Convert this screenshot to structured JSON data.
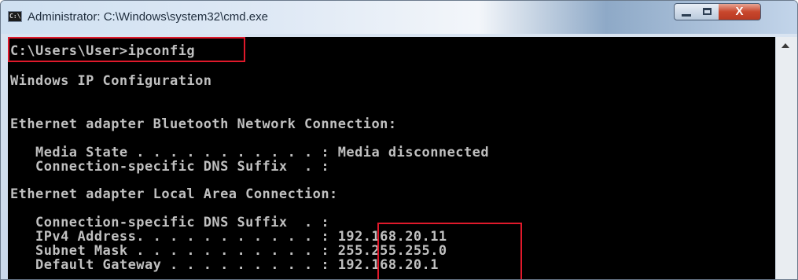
{
  "window": {
    "title": "Administrator: C:\\Windows\\system32\\cmd.exe",
    "icon": "cmd-icon",
    "icon_text": "C:\\",
    "controls": {
      "minimize": "minimize-icon",
      "maximize": "maximize-icon",
      "close": "close-icon"
    },
    "close_glyph": "X"
  },
  "console": {
    "lines": [
      "C:\\Users\\User>ipconfig",
      "Windows IP Configuration",
      "Ethernet adapter Bluetooth Network Connection:",
      "   Media State . . . . . . . . . . . : Media disconnected",
      "   Connection-specific DNS Suffix  . :",
      "Ethernet adapter Local Area Connection:",
      "   Connection-specific DNS Suffix  . :",
      "   IPv4 Address. . . . . . . . . . . : 192.168.20.11",
      "   Subnet Mask . . . . . . . . . . . : 255.255.255.0",
      "   Default Gateway . . . . . . . . . : 192.168.20.1"
    ]
  },
  "colors": {
    "highlight": "#e0192b",
    "console_bg": "#000000",
    "console_text": "#c0c0c0"
  }
}
